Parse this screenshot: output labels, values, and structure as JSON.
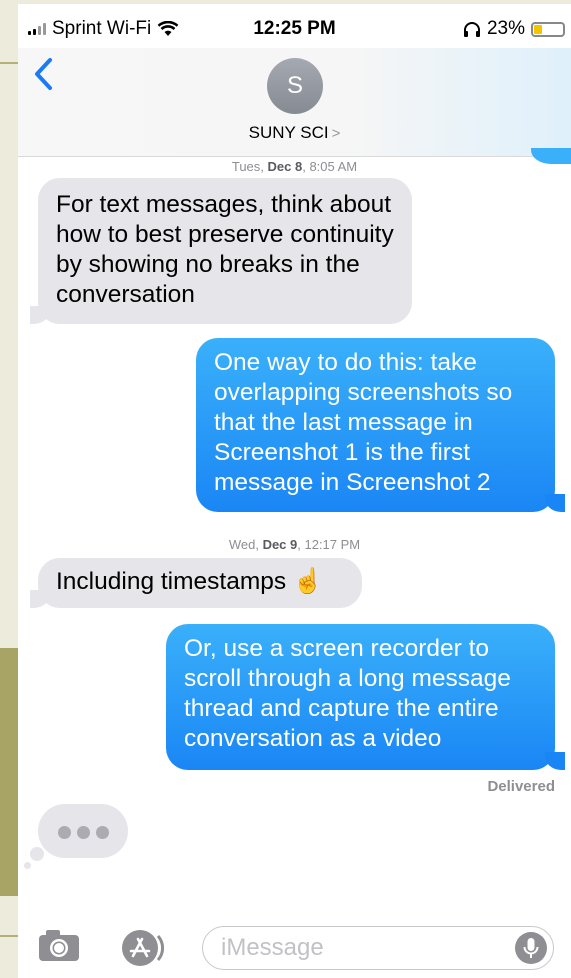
{
  "status_bar": {
    "carrier": "Sprint Wi-Fi",
    "time": "12:25 PM",
    "battery_percent": "23%",
    "battery_color": "#f2c500",
    "icons": [
      "signal-icon",
      "wifi-icon",
      "headphones-icon",
      "battery-icon"
    ]
  },
  "header": {
    "avatar_initial": "S",
    "contact_name": "SUNY SCI",
    "contact_chevron": ">",
    "back_icon": "chevron-left-icon"
  },
  "timestamps": [
    {
      "day": "Tues, ",
      "date": "Dec 8",
      "time": ", 8:05 AM"
    },
    {
      "day": "Wed, ",
      "date": "Dec 9",
      "time": ", 12:17 PM"
    }
  ],
  "messages": [
    {
      "direction": "incoming",
      "text": "For text messages, think about how to best preserve continuity by showing no breaks in the conversation"
    },
    {
      "direction": "outgoing",
      "text": "One way to do this: take overlapping screenshots so that the last message in Screenshot 1 is the first message in Screenshot 2"
    },
    {
      "direction": "incoming",
      "text": "Including timestamps ☝️"
    },
    {
      "direction": "outgoing",
      "text": "Or, use a screen recorder to scroll through a long message thread and capture the entire conversation as a video"
    }
  ],
  "delivery_status": "Delivered",
  "typing_indicator": true,
  "input_bar": {
    "placeholder": "iMessage",
    "icons": [
      "camera-icon",
      "app-store-icon",
      "microphone-icon"
    ]
  },
  "colors": {
    "incoming_bubble": "#e5e5ea",
    "outgoing_bubble": "#1a86f5",
    "accent": "#1a7cf5"
  }
}
